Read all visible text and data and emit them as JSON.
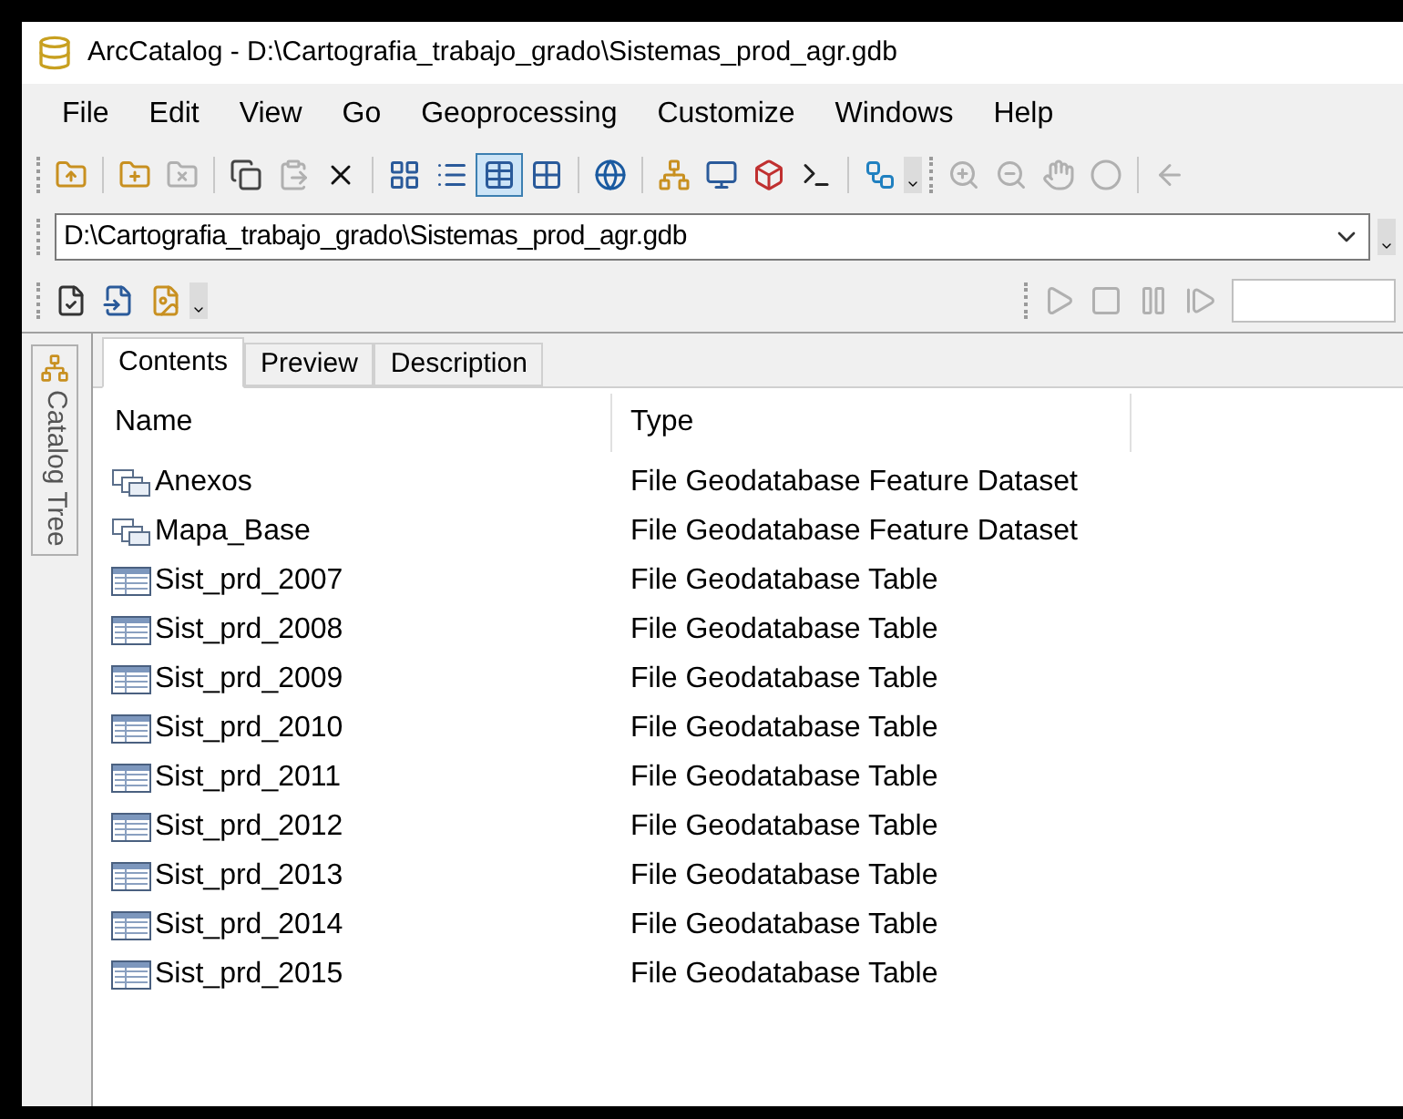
{
  "window": {
    "title": "ArcCatalog - D:\\Cartografia_trabajo_grado\\Sistemas_prod_agr.gdb"
  },
  "menu": [
    "File",
    "Edit",
    "View",
    "Go",
    "Geoprocessing",
    "Customize",
    "Windows",
    "Help"
  ],
  "view_buttons": [
    {
      "selected": false
    },
    {
      "selected": false
    },
    {
      "selected": true
    },
    {
      "selected": false
    }
  ],
  "location": {
    "value": "D:\\Cartografia_trabajo_grado\\Sistemas_prod_agr.gdb"
  },
  "side_tab": {
    "label": "Catalog Tree"
  },
  "tabs": [
    {
      "label": "Contents",
      "selected": true
    },
    {
      "label": "Preview",
      "selected": false
    },
    {
      "label": "Description",
      "selected": false
    }
  ],
  "table": {
    "columns": [
      "Name",
      "Type"
    ],
    "rows": [
      {
        "kind": "dataset",
        "name": "Anexos",
        "type": "File Geodatabase Feature Dataset"
      },
      {
        "kind": "dataset",
        "name": "Mapa_Base",
        "type": "File Geodatabase Feature Dataset"
      },
      {
        "kind": "table",
        "name": "Sist_prd_2007",
        "type": "File Geodatabase Table"
      },
      {
        "kind": "table",
        "name": "Sist_prd_2008",
        "type": "File Geodatabase Table"
      },
      {
        "kind": "table",
        "name": "Sist_prd_2009",
        "type": "File Geodatabase Table"
      },
      {
        "kind": "table",
        "name": "Sist_prd_2010",
        "type": "File Geodatabase Table"
      },
      {
        "kind": "table",
        "name": "Sist_prd_2011",
        "type": "File Geodatabase Table"
      },
      {
        "kind": "table",
        "name": "Sist_prd_2012",
        "type": "File Geodatabase Table"
      },
      {
        "kind": "table",
        "name": "Sist_prd_2013",
        "type": "File Geodatabase Table"
      },
      {
        "kind": "table",
        "name": "Sist_prd_2014",
        "type": "File Geodatabase Table"
      },
      {
        "kind": "table",
        "name": "Sist_prd_2015",
        "type": "File Geodatabase Table"
      }
    ]
  }
}
